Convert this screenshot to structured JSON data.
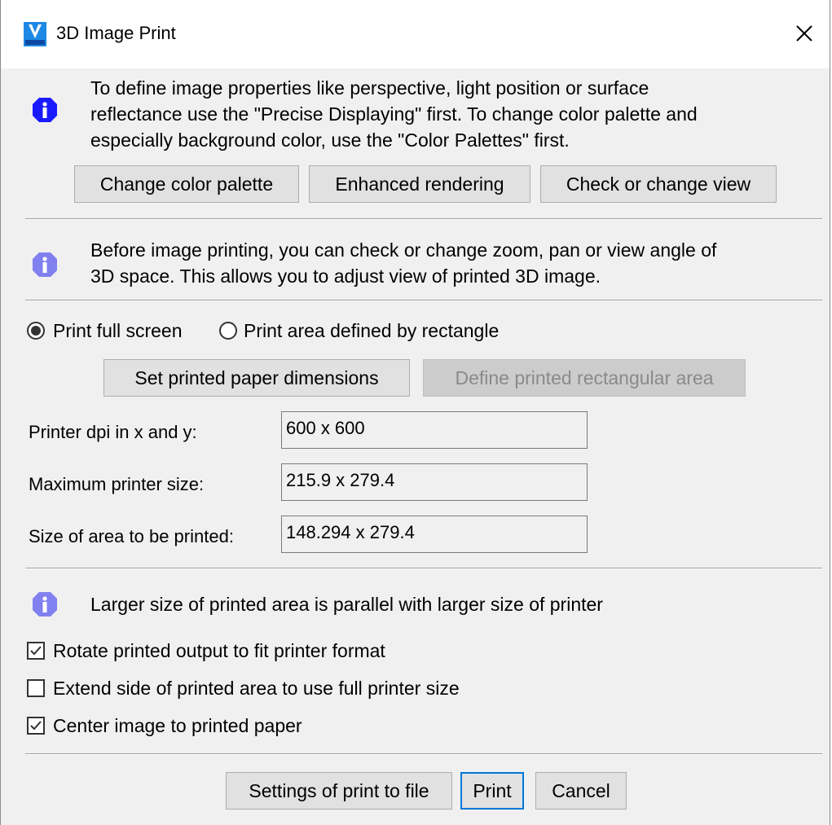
{
  "window": {
    "title": "3D Image Print"
  },
  "info1": {
    "lines": [
      "To define image properties like perspective, light position or surface",
      "reflectance use the \"Precise Displaying\" first. To change color palette and",
      "especially background color, use the \"Color Palettes\" first."
    ]
  },
  "top_buttons": {
    "change_palette": "Change color palette",
    "enhanced_rendering": "Enhanced rendering",
    "check_view": "Check or change view"
  },
  "info2": {
    "lines": [
      "Before image printing, you can check or change zoom, pan or view angle of",
      "3D space. This allows you to adjust view of printed 3D image."
    ]
  },
  "print_mode": {
    "full_screen": "Print full screen",
    "rectangle": "Print area defined by rectangle",
    "selected": "full_screen"
  },
  "area_buttons": {
    "set_dimensions": "Set printed paper dimensions",
    "define_area": "Define printed rectangular area"
  },
  "fields": {
    "dpi_label": "Printer dpi in x and y:",
    "dpi_value": "600 x 600",
    "max_size_label": "Maximum printer size:",
    "max_size_value": "215.9 x 279.4",
    "area_size_label": "Size of area to be printed:",
    "area_size_value": "148.294 x 279.4"
  },
  "info3": {
    "text": "Larger size of printed area is parallel with larger size of printer"
  },
  "options": {
    "rotate": {
      "label": "Rotate printed output to fit printer format",
      "checked": true
    },
    "extend": {
      "label": "Extend side of printed area to use full printer size",
      "checked": false
    },
    "center": {
      "label": "Center image to printed paper",
      "checked": true
    }
  },
  "footer": {
    "settings_file": "Settings of print to file",
    "print": "Print",
    "cancel": "Cancel"
  },
  "colors": {
    "info_icon_strong": "#1a1aff",
    "info_icon_light": "#8080f0",
    "accent": "#0078d7"
  },
  "icons": {
    "app": "app-logo-icon",
    "close": "close-icon",
    "info": "info-icon"
  }
}
